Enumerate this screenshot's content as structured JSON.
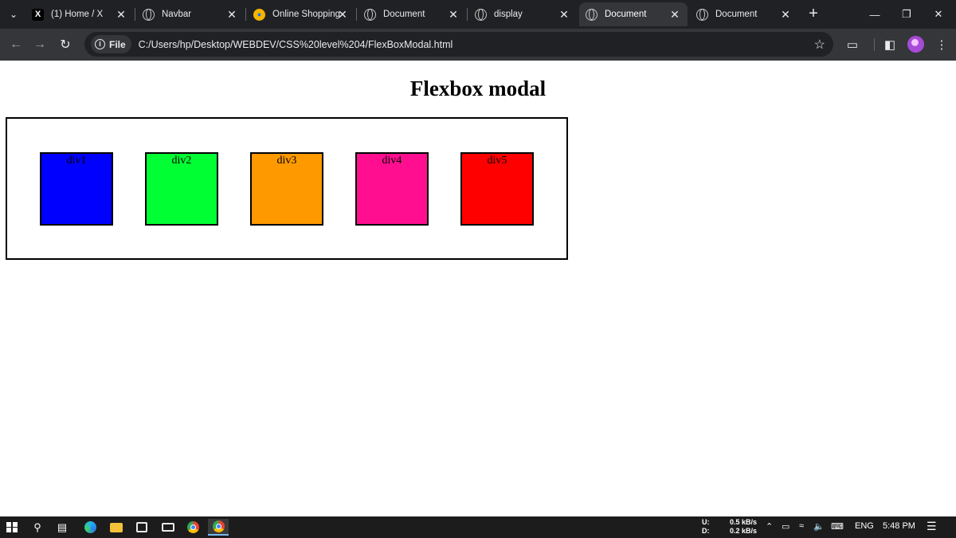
{
  "browser": {
    "tabs": [
      {
        "title": "(1) Home / X",
        "icon": "x-logo-icon",
        "active": false
      },
      {
        "title": "Navbar",
        "icon": "globe-icon",
        "active": false
      },
      {
        "title": "Online Shopping",
        "icon": "shopping-icon",
        "active": false
      },
      {
        "title": "Document",
        "icon": "globe-icon",
        "active": false
      },
      {
        "title": "display",
        "icon": "globe-icon",
        "active": false
      },
      {
        "title": "Document",
        "icon": "globe-icon",
        "active": true
      },
      {
        "title": "Document",
        "icon": "globe-icon",
        "active": false
      }
    ],
    "address": {
      "chip_label": "File",
      "url": "C:/Users/hp/Desktop/WEBDEV/CSS%20level%204/FlexBoxModal.html"
    }
  },
  "page": {
    "heading": "Flexbox modal",
    "boxes": [
      {
        "label": "div1",
        "color": "#0000ff"
      },
      {
        "label": "div2",
        "color": "#00ff33"
      },
      {
        "label": "div3",
        "color": "#ff9900"
      },
      {
        "label": "div4",
        "color": "#ff0f8f"
      },
      {
        "label": "div5",
        "color": "#ff0000"
      }
    ]
  },
  "taskbar": {
    "network": {
      "upload_label": "U:",
      "upload_value": "0.5 kB/s",
      "download_label": "D:",
      "download_value": "0.2 kB/s"
    },
    "language": "ENG",
    "time": "5:48 PM"
  }
}
